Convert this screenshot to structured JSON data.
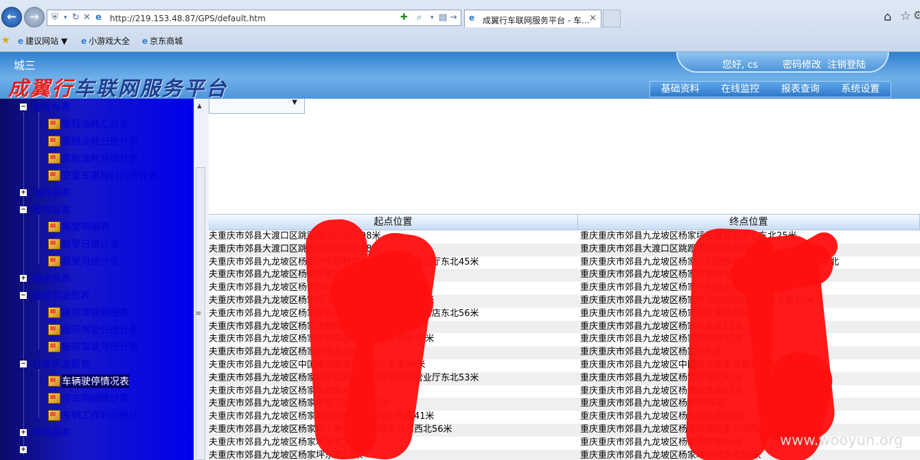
{
  "browser": {
    "url": "http://219.153.48.87/GPS/default.htm",
    "tab_title": "成翼行车联网服务平台 - 车...",
    "tab_close": "×",
    "favorites": [
      {
        "label": "建议网站 ▼"
      },
      {
        "label": "小游戏大全"
      },
      {
        "label": "京东商城"
      }
    ]
  },
  "header": {
    "org": "城三",
    "title_highlight": "成翼行",
    "title_rest": "车联网服务平台",
    "greeting": "您好, cs",
    "password_link": "密码修改",
    "logout_link": "注销登陆",
    "menu": [
      "基础资料",
      "在线监控",
      "报表查询",
      "系统设置"
    ]
  },
  "sidebar": {
    "items": [
      {
        "type": "category",
        "toggle": "−",
        "label": "里程报表"
      },
      {
        "type": "leaf",
        "label": "里程油耗汇总表"
      },
      {
        "type": "leaf",
        "label": "里程油耗日统计表"
      },
      {
        "type": "leaf",
        "label": "里程油耗月统计表"
      },
      {
        "type": "leaf",
        "label": "空重车里程时间统计表"
      },
      {
        "type": "category",
        "toggle": "+",
        "label": "油耗报表"
      },
      {
        "type": "category",
        "toggle": "−",
        "label": "警情报表"
      },
      {
        "type": "leaf",
        "label": "报警明细表"
      },
      {
        "type": "leaf",
        "label": "报警日统计表"
      },
      {
        "type": "leaf",
        "label": "报警月统计表"
      },
      {
        "type": "category",
        "toggle": "+",
        "label": "超速报表"
      },
      {
        "type": "category",
        "toggle": "−",
        "label": "疲劳驾驶报表"
      },
      {
        "type": "leaf",
        "label": "疲劳驾驶明细表"
      },
      {
        "type": "leaf",
        "label": "疲劳驾驶日统计表"
      },
      {
        "type": "leaf",
        "label": "疲劳驾驶月统计表"
      },
      {
        "type": "category",
        "toggle": "−",
        "label": "行驶状态报表"
      },
      {
        "type": "leaf",
        "label": "车辆驶停情况表",
        "selected": true
      },
      {
        "type": "leaf",
        "label": "停车明细统计表"
      },
      {
        "type": "leaf",
        "label": "车辆工作时间统计"
      },
      {
        "type": "category",
        "toggle": "+",
        "label": "其他报表"
      },
      {
        "type": "category",
        "toggle": "+",
        "label": ""
      }
    ]
  },
  "table": {
    "headers": [
      "起点位置",
      "终点位置"
    ],
    "rows": [
      [
        "夫重庆市郊县大渡口区跳蹬镇政府西北98米",
        "重庆重庆市郊县九龙坡区杨家坪街道营运中心东北25米"
      ],
      [
        "夫重庆市郊县大渡口区跳蹬镇政府西北98米",
        "重庆重庆市郊县大渡口区跳蹬镇政府西北98米"
      ],
      [
        "夫重庆市郊县九龙坡区杨家坪中国移动杨家坪步行街营业厅东北45米",
        "重庆重庆市郊县九龙坡区杨家坪中国移动杨家坪步行街营业厅东北"
      ],
      [
        "夫重庆市郊县九龙坡区杨家坪美容服务西南54米",
        "重庆重庆市郊县九龙坡区杨家坪美容服务东南37米"
      ],
      [
        "夫重庆市郊县九龙坡区杨家坪站西南18米",
        "重庆重庆市郊县九龙坡区杨家坪街道支行西南18米"
      ],
      [
        "夫重庆市郊县九龙坡区杨家坪消防预防控制中心东南34米",
        "重庆重庆市郊县九龙坡区杨家坪消防预防控制中心东南45米"
      ],
      [
        "夫重庆市郊县九龙坡区杨家坪五星旅馆重庆杨家坪步行街店东北56米",
        "重庆重庆市郊县九龙坡区杨家坪大厦西北60米"
      ],
      [
        "夫重庆市郊县九龙坡区杨家坪购物城东南110米",
        "重庆重庆市郊县九龙坡区杨家坪东南11米"
      ],
      [
        "夫重庆市郊县九龙坡区杨家坪全国连锁黄桷坪店西南46米",
        "重庆重庆市郊县九龙坡区杨家坪西南47米"
      ],
      [
        "夫重庆市郊县九龙坡区杨家坪东北107米",
        "重庆重庆市郊县九龙坡区杨家坪东北"
      ],
      [
        "夫重庆市郊县九龙坡区中国移动谢家湾营业厅东南96米",
        "重庆重庆市郊县九龙坡区中国移动谢家湾营业厅东南96米"
      ],
      [
        "夫重庆市郊县九龙坡区杨家坪中国移动杨家坪步行街营业厅东北53米",
        "重庆重庆市郊县九龙坡区杨家坪东北37米"
      ],
      [
        "夫重庆市郊县九龙坡区杨家坪西南47米",
        "重庆重庆市郊县九龙坡区杨家坪西南52米"
      ],
      [
        "夫重庆市郊县九龙坡区杨家坪出入口东南53米",
        "重庆重庆市郊县九龙坡区杨家坪56米"
      ],
      [
        "夫重庆市郊县九龙坡区杨家坪疾病预防控制中心东南41米",
        "重庆重庆市郊县九龙坡区杨家坪东南56米"
      ],
      [
        "夫重庆市郊县九龙坡区杨家坪人寿保险九龙坡支公司西北56米",
        "重庆重庆市郊县九龙坡区杨家坪保险支公司西北56米"
      ],
      [
        "夫重庆市郊县九龙坡区杨家坪东北35米",
        "重庆重庆市郊县九龙坡区杨家坪东南56米"
      ],
      [
        "夫重庆市郊县九龙坡区杨家坪东南53米",
        "重庆重庆市郊县九龙坡区杨家坪学校东南53米"
      ]
    ]
  },
  "watermark": "www.wooyun.org",
  "colors": {
    "annotation": "#ff1010",
    "sidebar_bg": "#0000ee",
    "header_bg": "#2e7fcf"
  }
}
